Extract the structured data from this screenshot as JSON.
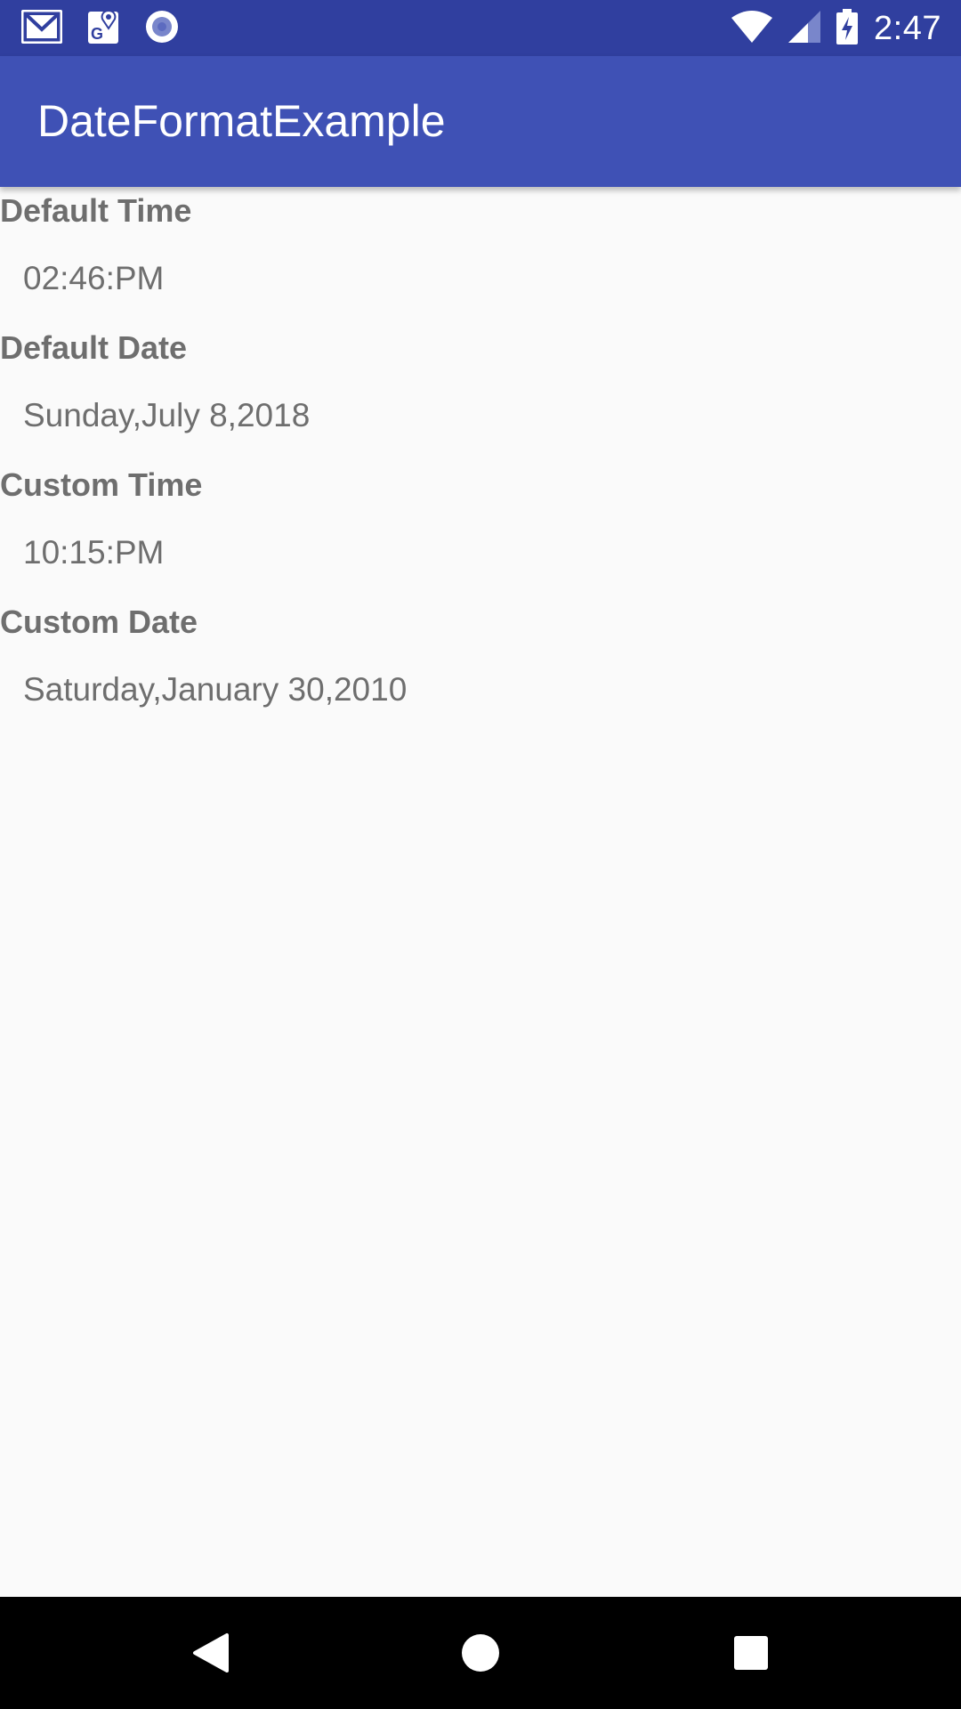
{
  "status_bar": {
    "time": "2:47",
    "icons": [
      "gmail-icon",
      "maps-icon",
      "sync-circle-icon",
      "wifi-icon",
      "signal-icon",
      "battery-charging-icon"
    ]
  },
  "app_bar": {
    "title": "DateFormatExample"
  },
  "fields": [
    {
      "label": "Default Time",
      "value": "02:46:PM"
    },
    {
      "label": "Default Date",
      "value": "Sunday,July 8,2018"
    },
    {
      "label": "Custom Time",
      "value": "10:15:PM"
    },
    {
      "label": "Custom Date",
      "value": "Saturday,January 30,2010"
    }
  ],
  "nav_bar": {
    "buttons": [
      "back-icon",
      "home-icon",
      "recents-icon"
    ]
  },
  "colors": {
    "status_bar": "#303f9f",
    "app_bar": "#3f51b5",
    "text": "#6e6e6e",
    "background": "#fafafa"
  }
}
